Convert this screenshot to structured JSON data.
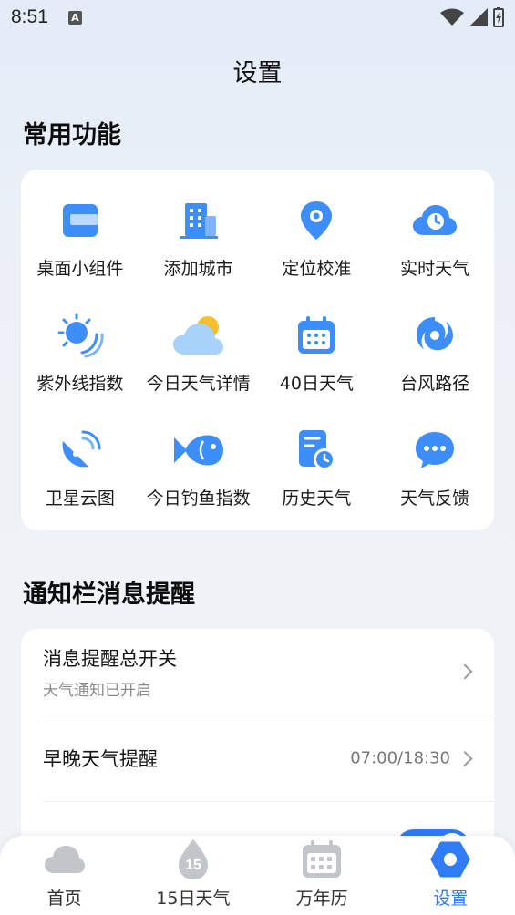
{
  "status_bar": {
    "time": "8:51",
    "notification_icon": "A"
  },
  "page": {
    "title": "设置"
  },
  "common": {
    "title": "常用功能",
    "items": [
      {
        "label": "桌面小组件",
        "icon": "widget-icon"
      },
      {
        "label": "添加城市",
        "icon": "building-icon"
      },
      {
        "label": "定位校准",
        "icon": "location-pin-icon"
      },
      {
        "label": "实时天气",
        "icon": "cloud-clock-icon"
      },
      {
        "label": "紫外线指数",
        "icon": "sun-uv-icon"
      },
      {
        "label": "今日天气详情",
        "icon": "sun-cloud-icon"
      },
      {
        "label": "40日天气",
        "icon": "calendar-icon"
      },
      {
        "label": "台风路径",
        "icon": "typhoon-icon"
      },
      {
        "label": "卫星云图",
        "icon": "satellite-icon"
      },
      {
        "label": "今日钓鱼指数",
        "icon": "fish-icon"
      },
      {
        "label": "历史天气",
        "icon": "history-doc-icon"
      },
      {
        "label": "天气反馈",
        "icon": "chat-bubble-icon"
      }
    ]
  },
  "notify": {
    "title": "通知栏消息提醒",
    "rows": [
      {
        "title": "消息提醒总开关",
        "subtitle": "天气通知已开启"
      },
      {
        "title": "早晚天气提醒",
        "value": "07:00/18:30"
      }
    ]
  },
  "bottom_nav": {
    "items": [
      {
        "label": "首页",
        "icon": "cloud-icon"
      },
      {
        "label": "15日天气",
        "icon": "drop-15-icon",
        "badge": "15"
      },
      {
        "label": "万年历",
        "icon": "calendar-grid-icon"
      },
      {
        "label": "设置",
        "icon": "settings-hex-icon",
        "active": true
      }
    ]
  },
  "colors": {
    "accent": "#2f7cf6",
    "icon_blue": "#3d8ef8"
  }
}
